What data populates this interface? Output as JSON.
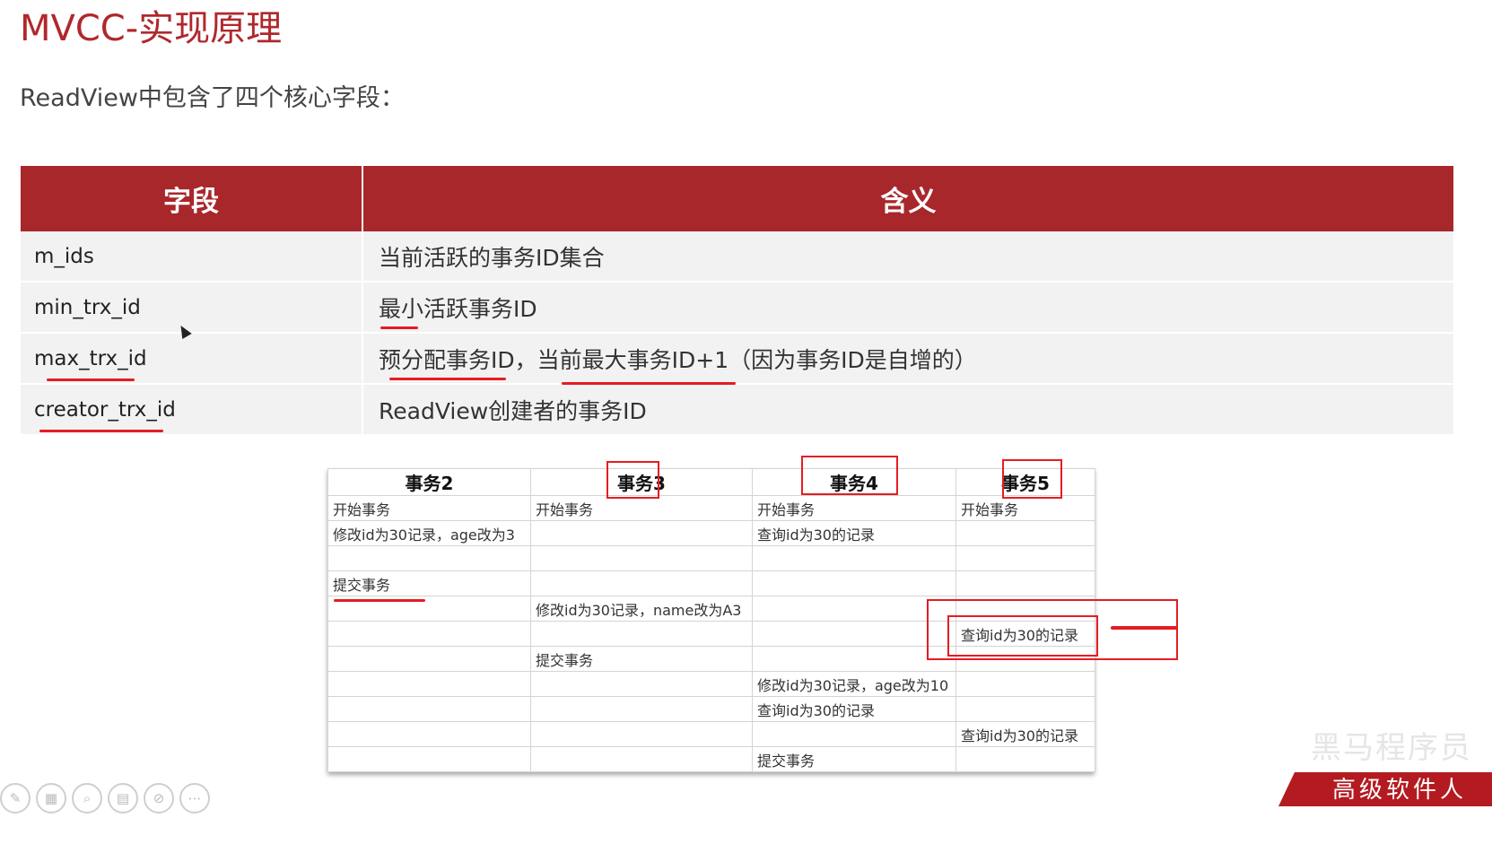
{
  "slide": {
    "title": "MVCC-实现原理",
    "subtitle": "ReadView中包含了四个核心字段："
  },
  "fields_table": {
    "headers": [
      "字段",
      "含义"
    ],
    "rows": [
      {
        "field": "m_ids",
        "meaning": "当前活跃的事务ID集合"
      },
      {
        "field": "min_trx_id",
        "meaning": "最小活跃事务ID"
      },
      {
        "field": "max_trx_id",
        "meaning": "预分配事务ID，当前最大事务ID+1（因为事务ID是自增的）"
      },
      {
        "field": "creator_trx_id",
        "meaning": "ReadView创建者的事务ID"
      }
    ]
  },
  "transactions": {
    "headers": [
      "事务2",
      "事务3",
      "事务4",
      "事务5"
    ],
    "rows": [
      [
        "开始事务",
        "开始事务",
        "开始事务",
        "开始事务"
      ],
      [
        "修改id为30记录，age改为3",
        "",
        "查询id为30的记录",
        ""
      ],
      [
        "",
        "",
        "",
        ""
      ],
      [
        "提交事务",
        "",
        "",
        ""
      ],
      [
        "",
        "修改id为30记录，name改为A3",
        "",
        ""
      ],
      [
        "",
        "",
        "",
        "查询id为30的记录"
      ],
      [
        "",
        "提交事务",
        "",
        ""
      ],
      [
        "",
        "",
        "修改id为30记录，age改为10",
        ""
      ],
      [
        "",
        "",
        "查询id为30的记录",
        ""
      ],
      [
        "",
        "",
        "",
        "查询id为30的记录"
      ],
      [
        "",
        "",
        "提交事务",
        ""
      ]
    ]
  },
  "toolbar": {
    "icons": [
      "pen-icon",
      "slides-icon",
      "zoom-icon",
      "subtitles-icon",
      "no-video-icon",
      "more-icon"
    ]
  },
  "branding": {
    "banner_text": "高级软件人才",
    "watermark": "黑马程序员"
  },
  "colors": {
    "accent": "#a8272b",
    "annotation": "#e51c23"
  }
}
